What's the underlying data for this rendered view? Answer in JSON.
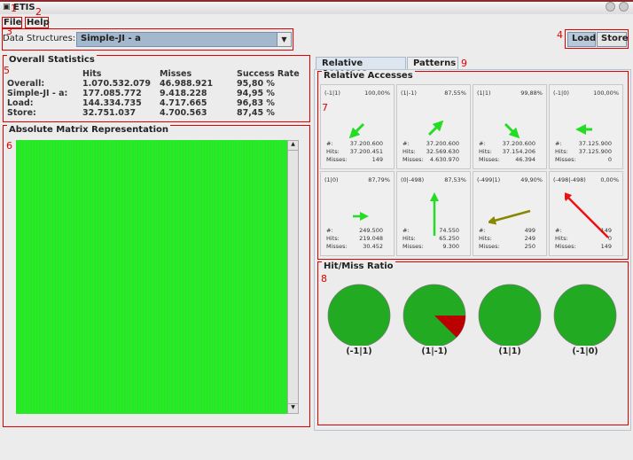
{
  "window": {
    "title": "ETIS"
  },
  "menu": {
    "file": "File",
    "help": "Help"
  },
  "toolbar": {
    "ds_label": "Data Structures:",
    "ds_value": "Simple-JI - a",
    "load": "Load",
    "store": "Store"
  },
  "annotations": [
    "1",
    "2",
    "3",
    "4",
    "5",
    "6",
    "7",
    "8",
    "9"
  ],
  "overall": {
    "title": "Overall Statistics",
    "headers": [
      "",
      "Hits",
      "Misses",
      "Success Rate"
    ],
    "rows": [
      [
        "Overall:",
        "1.070.532.079",
        "46.988.921",
        "95,80 %"
      ],
      [
        "Simple-JI - a:",
        "177.085.772",
        "9.418.228",
        "94,95 %"
      ],
      [
        "Load:",
        "144.334.735",
        "4.717.665",
        "96,83 %"
      ],
      [
        "Store:",
        "32.751.037",
        "4.700.563",
        "87,45 %"
      ]
    ]
  },
  "matrix": {
    "title": "Absolute Matrix Representation",
    "fill_color": "#22ee22"
  },
  "tabs": [
    {
      "label": "Relative Accesses",
      "active": true
    },
    {
      "label": "Patterns",
      "active": false
    }
  ],
  "relative": {
    "title": "Relative Accesses",
    "labels": {
      "count": "#:",
      "hits": "Hits:",
      "misses": "Misses:"
    },
    "cells": [
      {
        "key": "(-1|1)",
        "pct": "100,00%",
        "count": "37.200.600",
        "hits": "37.200.451",
        "misses": "149",
        "color": "#22dd22",
        "arrow": "down-left-icon"
      },
      {
        "key": "(1|-1)",
        "pct": "87,55%",
        "count": "37.200.600",
        "hits": "32.569.630",
        "misses": "4.630.970",
        "color": "#22dd22",
        "arrow": "up-right-icon"
      },
      {
        "key": "(1|1)",
        "pct": "99,88%",
        "count": "37.200.600",
        "hits": "37.154.206",
        "misses": "46.394",
        "color": "#22dd22",
        "arrow": "down-right-icon"
      },
      {
        "key": "(-1|0)",
        "pct": "100,00%",
        "count": "37.125.900",
        "hits": "37.125.900",
        "misses": "0",
        "color": "#22dd22",
        "arrow": "left-icon"
      },
      {
        "key": "(1|0)",
        "pct": "87,79%",
        "count": "249.500",
        "hits": "219.048",
        "misses": "30.452",
        "color": "#22dd22",
        "arrow": "right-icon"
      },
      {
        "key": "(0|-498)",
        "pct": "87,53%",
        "count": "74.550",
        "hits": "65.250",
        "misses": "9.300",
        "color": "#22dd22",
        "arrow": "up-icon"
      },
      {
        "key": "(-499|1)",
        "pct": "49,90%",
        "count": "499",
        "hits": "249",
        "misses": "250",
        "color": "#888800",
        "arrow": "left-icon"
      },
      {
        "key": "(-498|-498)",
        "pct": "0,00%",
        "count": "149",
        "hits": "0",
        "misses": "149",
        "color": "#ee1111",
        "arrow": "up-left-icon"
      }
    ]
  },
  "hitmiss": {
    "title": "Hit/Miss Ratio",
    "hit_color": "#22aa22",
    "miss_color": "#bb0000",
    "pies": [
      {
        "label": "(-1|1)",
        "hit_pct": 100
      },
      {
        "label": "(1|-1)",
        "hit_pct": 87.55
      },
      {
        "label": "(1|1)",
        "hit_pct": 99.88
      },
      {
        "label": "(-1|0)",
        "hit_pct": 100
      }
    ]
  }
}
